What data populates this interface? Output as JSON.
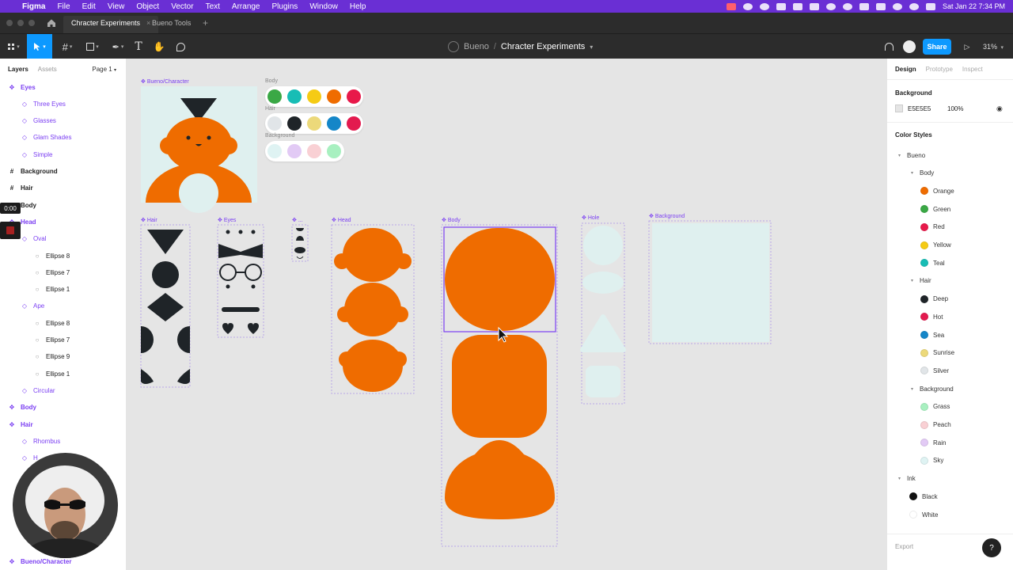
{
  "menubar": {
    "app": "Figma",
    "items": [
      "File",
      "Edit",
      "View",
      "Object",
      "Vector",
      "Text",
      "Arrange",
      "Plugins",
      "Window",
      "Help"
    ],
    "datetime": "Sat Jan 22  7:34 PM"
  },
  "tabs": [
    {
      "label": "Chracter Experiments",
      "active": true
    },
    {
      "label": "Bueno Tools",
      "active": false
    }
  ],
  "toolbar": {
    "team": "Bueno",
    "separator": "/",
    "file": "Chracter Experiments",
    "share_label": "Share",
    "zoom": "31%"
  },
  "left_panel": {
    "tab_layers": "Layers",
    "tab_assets": "Assets",
    "page": "Page 1",
    "layers": [
      {
        "label": "Eyes",
        "icon": "component",
        "top": true
      },
      {
        "label": "Three Eyes",
        "icon": "instance"
      },
      {
        "label": "Glasses",
        "icon": "instance"
      },
      {
        "label": "Glam Shades",
        "icon": "instance"
      },
      {
        "label": "Simple",
        "icon": "instance"
      },
      {
        "label": "Background",
        "icon": "frame",
        "bold": true
      },
      {
        "label": "Hair",
        "icon": "frame",
        "bold": true
      },
      {
        "label": "Body",
        "icon": "frame",
        "bold": true
      },
      {
        "label": "Head",
        "icon": "component",
        "top": true
      },
      {
        "label": "Oval",
        "icon": "instance"
      },
      {
        "label": "Ellipse 8",
        "icon": "ellipse"
      },
      {
        "label": "Ellipse 7",
        "icon": "ellipse"
      },
      {
        "label": "Ellipse 1",
        "icon": "ellipse"
      },
      {
        "label": "Ape",
        "icon": "instance"
      },
      {
        "label": "Ellipse 8",
        "icon": "ellipse"
      },
      {
        "label": "Ellipse 7",
        "icon": "ellipse"
      },
      {
        "label": "Ellipse 9",
        "icon": "ellipse"
      },
      {
        "label": "Ellipse 1",
        "icon": "ellipse"
      },
      {
        "label": "Circular",
        "icon": "instance"
      },
      {
        "label": "Body",
        "icon": "component",
        "top": true
      },
      {
        "label": "Hair",
        "icon": "component",
        "top": true
      },
      {
        "label": "Rhombus",
        "icon": "instance"
      },
      {
        "label": "H",
        "icon": "instance"
      }
    ],
    "bottom_layer": "Bueno/Character"
  },
  "overlay": {
    "timer": "0:00"
  },
  "canvas": {
    "character_frame_label": "Bueno/Character",
    "palette_labels": [
      "Body",
      "Hair",
      "Background"
    ],
    "frames": [
      "Hair",
      "Eyes",
      "...",
      "Head",
      "Body",
      "Hole",
      "Background"
    ]
  },
  "right_panel": {
    "tab_design": "Design",
    "tab_prototype": "Prototype",
    "tab_inspect": "Inspect",
    "background_title": "Background",
    "background_hex": "E5E5E5",
    "background_opacity": "100%",
    "color_styles_title": "Color Styles",
    "groups": [
      {
        "label": "Bueno",
        "level": 0
      },
      {
        "label": "Body",
        "level": 1
      },
      {
        "label": "Orange",
        "color": "#ef6c00",
        "level": 2
      },
      {
        "label": "Green",
        "color": "#3aa845",
        "level": 2
      },
      {
        "label": "Red",
        "color": "#e8194a",
        "level": 2
      },
      {
        "label": "Yellow",
        "color": "#f5cb14",
        "level": 2
      },
      {
        "label": "Teal",
        "color": "#17bdb5",
        "level": 2
      },
      {
        "label": "Hair",
        "level": 1
      },
      {
        "label": "Deep",
        "color": "#1f2428",
        "level": 2
      },
      {
        "label": "Hot",
        "color": "#e31a4f",
        "level": 2
      },
      {
        "label": "Sea",
        "color": "#1486c8",
        "level": 2
      },
      {
        "label": "Sunrise",
        "color": "#ecd97a",
        "level": 2
      },
      {
        "label": "Silver",
        "color": "#e1e5e8",
        "level": 2
      },
      {
        "label": "Background",
        "level": 1
      },
      {
        "label": "Grass",
        "color": "#a8f0c0",
        "level": 2
      },
      {
        "label": "Peach",
        "color": "#f9d0d4",
        "level": 2
      },
      {
        "label": "Rain",
        "color": "#e2caf5",
        "level": 2
      },
      {
        "label": "Sky",
        "color": "#dff3f3",
        "level": 2
      },
      {
        "label": "Ink",
        "level": 0
      },
      {
        "label": "Black",
        "color": "#111111",
        "level": 1
      },
      {
        "label": "White",
        "color": "#ffffff",
        "level": 1
      }
    ],
    "export_label": "Export",
    "help": "?"
  },
  "colors": {
    "accent": "#0d99ff",
    "component_purple": "#7b3ff2",
    "orange": "#ef6c00",
    "sky": "#dff0ef",
    "ink": "#1f2428"
  }
}
